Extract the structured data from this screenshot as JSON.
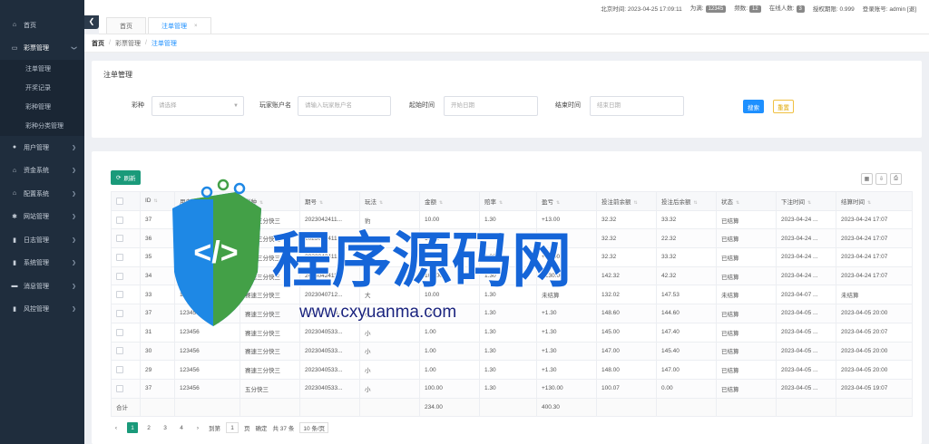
{
  "topbar": {
    "items": [
      {
        "label": "北京时间: 2023-04-25 17:09:11"
      },
      {
        "label": "为满:",
        "badge": "12345"
      },
      {
        "label": "频数:",
        "badge": "12"
      },
      {
        "label": "在线人数:",
        "badge": "3"
      },
      {
        "label": "授权期限: 0.999"
      },
      {
        "label": "登录账号: admin [退]"
      }
    ]
  },
  "sidebar": {
    "collapse_icon": "chevron-left-icon",
    "items": [
      {
        "label": "首页",
        "icon": "home-icon",
        "has_children": false
      },
      {
        "label": "彩票管理",
        "icon": "card-icon",
        "has_children": true,
        "active": true,
        "children": [
          "注单管理",
          "开奖记录",
          "彩种管理",
          "彩种分类管理"
        ]
      },
      {
        "label": "用户管理",
        "icon": "user-icon",
        "has_children": true
      },
      {
        "label": "资金系统",
        "icon": "bank-icon",
        "has_children": true
      },
      {
        "label": "配置系统",
        "icon": "bank-icon",
        "has_children": true
      },
      {
        "label": "网站管理",
        "icon": "gear-icon",
        "has_children": true
      },
      {
        "label": "日志管理",
        "icon": "bars-icon",
        "has_children": true
      },
      {
        "label": "系统管理",
        "icon": "bars-icon",
        "has_children": true
      },
      {
        "label": "消息管理",
        "icon": "chat-icon",
        "has_children": true
      },
      {
        "label": "风控管理",
        "icon": "bars-icon",
        "has_children": true
      }
    ]
  },
  "tabs": [
    {
      "label": "首页",
      "active": false
    },
    {
      "label": "注单管理",
      "active": true,
      "close": "×"
    }
  ],
  "breadcrumb": {
    "items": [
      "首页",
      "彩票管理",
      "注单管理"
    ]
  },
  "filter": {
    "title": "注单管理",
    "fields": [
      {
        "label": "彩种",
        "placeholder": "请选择"
      },
      {
        "label": "玩家账户名",
        "placeholder": "请输入玩家账户名"
      },
      {
        "label": "起始时间",
        "placeholder": "开始日期"
      },
      {
        "label": "结束时间",
        "placeholder": "结束日期"
      }
    ],
    "search_label": "搜索",
    "reset_label": "重置"
  },
  "table": {
    "refresh_label": "刷新",
    "headers": [
      "",
      "ID",
      "用户",
      "彩种",
      "期号",
      "玩法",
      "金额",
      "赔率",
      "盈亏",
      "投注前余额",
      "投注后余额",
      "状态",
      "下注时间",
      "结算时间"
    ],
    "rows": [
      [
        "37",
        "123456",
        "赛速三分快三",
        "2023042411...",
        "豹",
        "10.00",
        "1.30",
        "+13.00",
        "32.32",
        "33.32",
        "已结算",
        "2023-04-24 ...",
        "2023-04-24 17:07"
      ],
      [
        "36",
        "123456",
        "赛速三分快三",
        "2023042411...",
        "单",
        "10.00",
        "1.30",
        "-10.00",
        "32.32",
        "22.32",
        "已结算",
        "2023-04-24 ...",
        "2023-04-24 17:07"
      ],
      [
        "35",
        "123456",
        "赛速三分快三",
        "2023042411...",
        "大",
        "10.00",
        "1.30",
        "+13.00",
        "32.32",
        "33.32",
        "已结算",
        "2023-04-24 ...",
        "2023-04-24 17:07"
      ],
      [
        "34",
        "123456",
        "赛速三分快三",
        "2023042411...",
        "大",
        "100.00",
        "1.30",
        "+130.00",
        "142.32",
        "42.32",
        "已结算",
        "2023-04-24 ...",
        "2023-04-24 17:07"
      ],
      [
        "33",
        "123456",
        "赛速三分快三",
        "2023040712...",
        "大",
        "10.00",
        "1.30",
        "未结算",
        "132.02",
        "147.53",
        "未结算",
        "2023-04-07 ...",
        "未结算"
      ],
      [
        "37",
        "123456",
        "赛速三分快三",
        "2023040533...",
        "小",
        "1.00",
        "1.30",
        "+1.30",
        "148.60",
        "144.60",
        "已结算",
        "2023-04-05 ...",
        "2023-04-05 20:00"
      ],
      [
        "31",
        "123456",
        "赛速三分快三",
        "2023040533...",
        "小",
        "1.00",
        "1.30",
        "+1.30",
        "145.00",
        "147.40",
        "已结算",
        "2023-04-05 ...",
        "2023-04-05 20:07"
      ],
      [
        "30",
        "123456",
        "赛速三分快三",
        "2023040533...",
        "小",
        "1.00",
        "1.30",
        "+1.30",
        "147.00",
        "145.40",
        "已结算",
        "2023-04-05 ...",
        "2023-04-05 20:00"
      ],
      [
        "29",
        "123456",
        "赛速三分快三",
        "2023040533...",
        "小",
        "1.00",
        "1.30",
        "+1.30",
        "148.00",
        "147.00",
        "已结算",
        "2023-04-05 ...",
        "2023-04-05 20:00"
      ],
      [
        "37",
        "123456",
        "五分快三",
        "2023040533...",
        "小",
        "100.00",
        "1.30",
        "+130.00",
        "100.07",
        "0.00",
        "已结算",
        "2023-04-05 ...",
        "2023-04-05 19:07"
      ]
    ],
    "total": {
      "label": "合计",
      "amount": "234.00",
      "profit": "400.30"
    }
  },
  "pager": {
    "pages": [
      "1",
      "2",
      "3",
      "4"
    ],
    "current": "1",
    "goto_label": "到第",
    "goto_value": "1",
    "page_unit": "页",
    "confirm_label": "确定",
    "total_label": "共 37 条",
    "page_size": "10 条/页"
  },
  "watermark": {
    "brand_text": "程序源码网",
    "url_text": "www.cxyuanma.com",
    "icon_text": "</>",
    "colors": {
      "blue": "#1565d8",
      "shield": "#1e88e5",
      "green": "#43a047"
    }
  },
  "colors": {
    "sidebar": "#1f2d3d",
    "primary": "#1e90ff",
    "teal": "#1a9a7a",
    "positive": "#1f9d3a",
    "negative": "#e53935"
  }
}
